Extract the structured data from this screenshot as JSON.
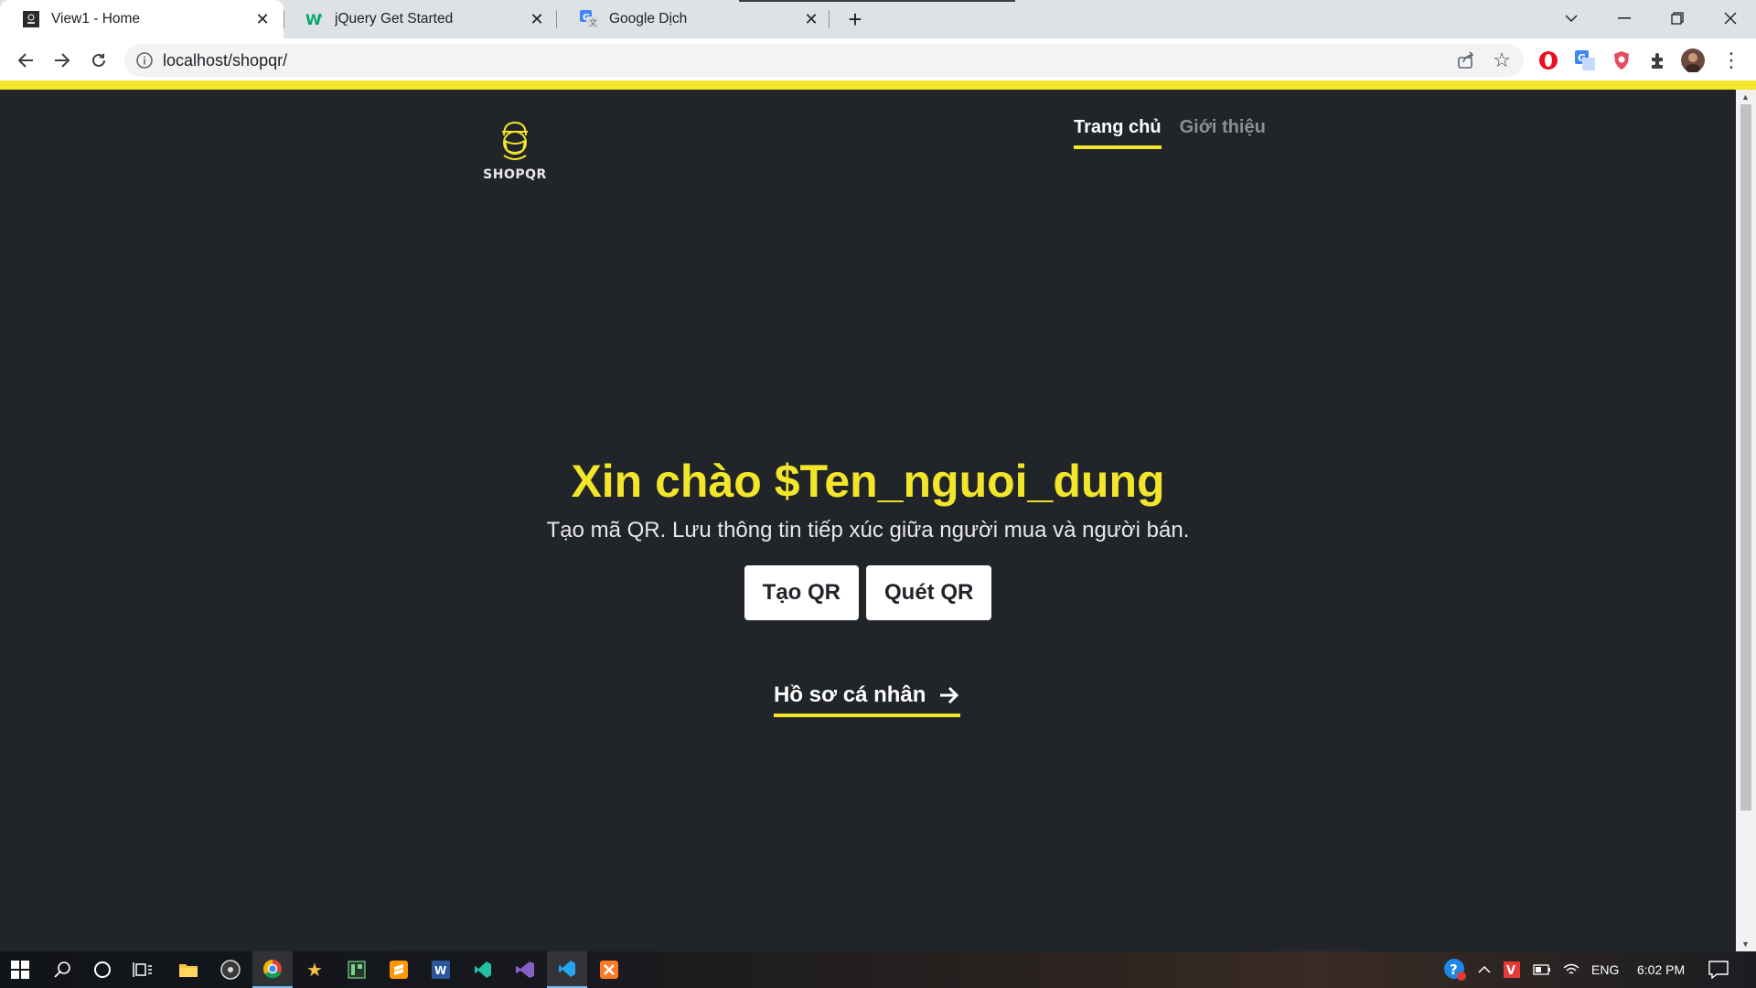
{
  "browser": {
    "tabs": [
      {
        "title": "View1 - Home",
        "active": true
      },
      {
        "title": "jQuery Get Started",
        "active": false
      },
      {
        "title": "Google Dịch",
        "active": false
      }
    ],
    "url": "localhost/shopqr/"
  },
  "page": {
    "brand": "SHOPQR",
    "nav": [
      {
        "label": "Trang chủ",
        "active": true
      },
      {
        "label": "Giới thiệu",
        "active": false
      }
    ],
    "greeting": "Xin chào $Ten_nguoi_dung",
    "subtitle": "Tạo mã QR. Lưu thông tin tiếp xúc giữa người mua và người bán.",
    "buttons": {
      "create": "Tạo QR",
      "scan": "Quét QR"
    },
    "profile_link": "Hồ sơ cá nhân"
  },
  "taskbar": {
    "language": "ENG",
    "time": "6:02 PM"
  },
  "colors": {
    "accent": "#f2e52a",
    "background": "#212529",
    "button_bg": "#ffffff"
  }
}
